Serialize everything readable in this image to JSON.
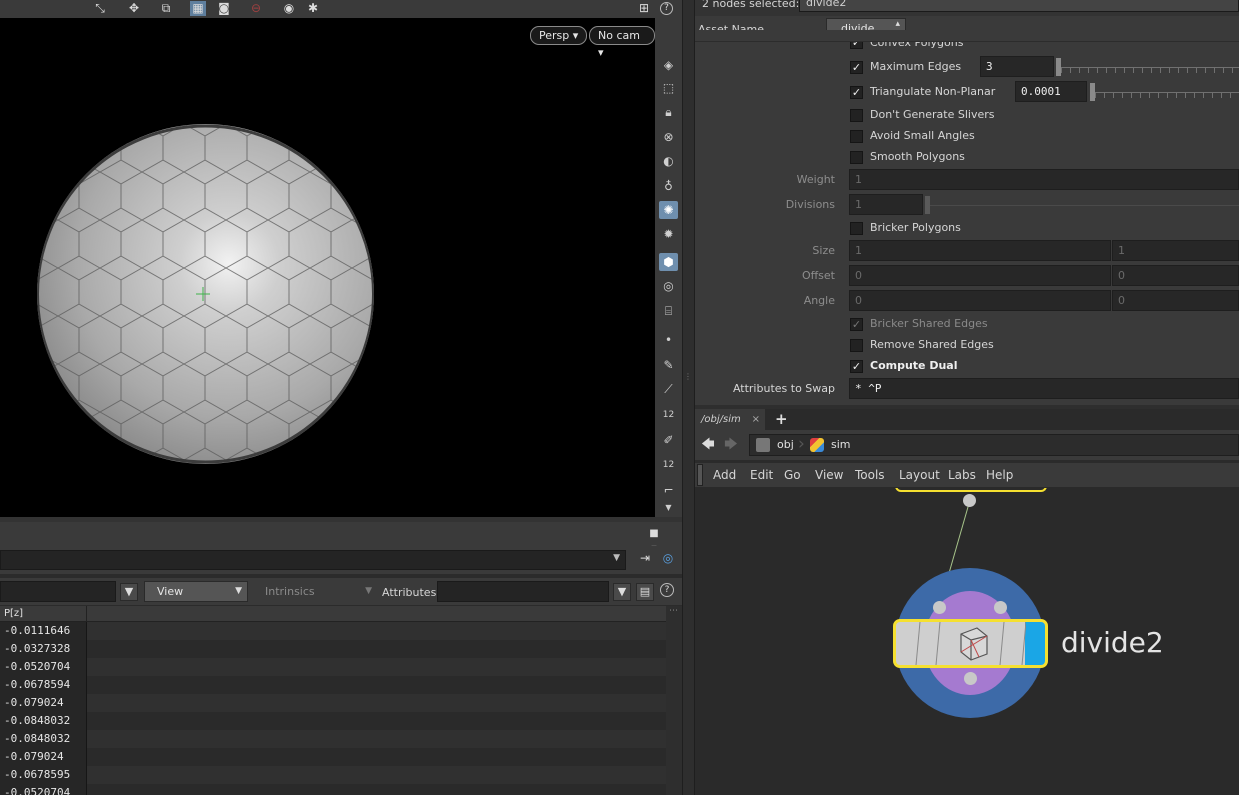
{
  "viewport": {
    "persp_label": "Persp",
    "cam_label": "No cam",
    "toolbar_icons": [
      "select-icon",
      "transform-icon",
      "handle-icon",
      "display-options-icon",
      "snapshot-icon",
      "ghost-icon",
      "camera-icon",
      "settings-icon"
    ],
    "side_tools": [
      "view-icon",
      "display-icon",
      "lock-icon",
      "hide-icon",
      "shading-icon",
      "light-icon",
      "headlight-icon",
      "dome-light-icon",
      "wireframe-icon",
      "visibility-icon",
      "template-icon",
      "point-icon",
      "draw-icon",
      "pick-icon",
      "numbers-icon",
      "brush-icon",
      "point-numbers-icon",
      "angle-icon"
    ]
  },
  "spreadsheet": {
    "view_label": "View",
    "intrinsics_label": "Intrinsics",
    "attributes_label": "Attributes:",
    "column_header": "P[z]",
    "rows": [
      "-0.0111646",
      "-0.0327328",
      "-0.0520704",
      "-0.0678594",
      "-0.079024",
      "-0.0848032",
      "-0.0848032",
      "-0.079024",
      "-0.0678595",
      "-0.0520704"
    ]
  },
  "parameters": {
    "nodes_selected_label": "2 nodes selected:",
    "nodes_selected_value": "divide2",
    "asset_name_label": "Asset Name",
    "asset_name_value": "divide",
    "convex_polygons_label": "Convex Polygons",
    "maximum_edges_label": "Maximum Edges",
    "maximum_edges_value": "3",
    "triangulate_label": "Triangulate Non-Planar",
    "triangulate_value": "0.0001",
    "dont_generate_slivers_label": "Don't Generate Slivers",
    "avoid_small_angles_label": "Avoid Small Angles",
    "smooth_polygons_label": "Smooth Polygons",
    "weight_label": "Weight",
    "weight_value": "1",
    "divisions_label": "Divisions",
    "divisions_value": "1",
    "bricker_polygons_label": "Bricker Polygons",
    "size_label": "Size",
    "size_x": "1",
    "size_y": "1",
    "offset_label": "Offset",
    "offset_x": "0",
    "offset_y": "0",
    "angle_label": "Angle",
    "angle_x": "0",
    "angle_y": "0",
    "bricker_shared_edges_label": "Bricker Shared Edges",
    "remove_shared_edges_label": "Remove Shared Edges",
    "compute_dual_label": "Compute Dual",
    "attributes_to_swap_label": "Attributes to Swap",
    "attributes_to_swap_value": "* ^P"
  },
  "network": {
    "tab_label": "/obj/sim",
    "tab_close": "×",
    "add_tab": "+",
    "path_obj": "obj",
    "path_sim": "sim",
    "menu": [
      "Add",
      "Edit",
      "Go",
      "View",
      "Tools",
      "Layout",
      "Labs",
      "Help"
    ],
    "node_name": "divide2",
    "colors": {
      "node_ring": "#3d6aa8",
      "node_inner": "#a57ad0",
      "selected_outline": "#f5e030",
      "display_flag": "#1aa6e6"
    }
  }
}
